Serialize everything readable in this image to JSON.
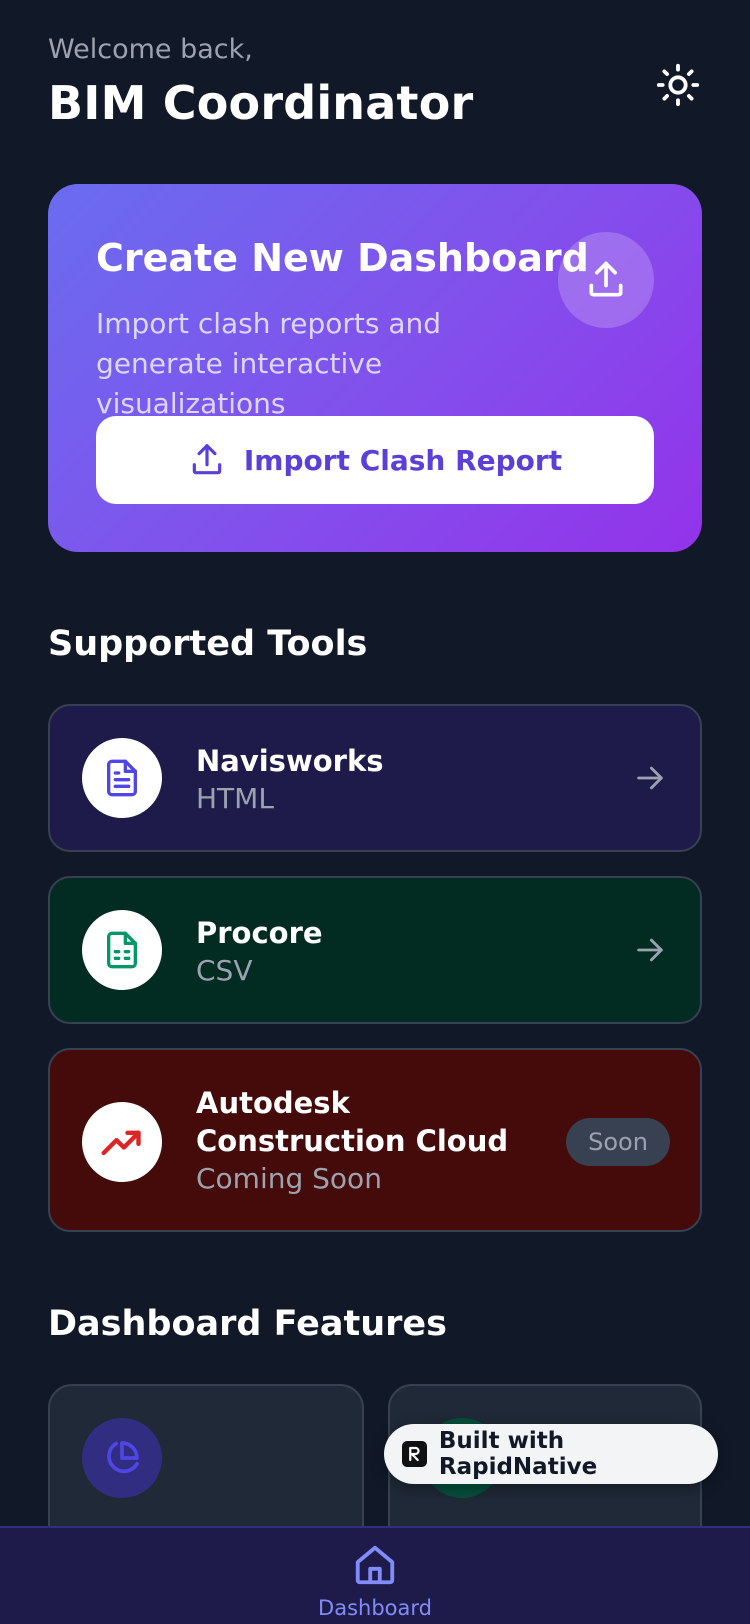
{
  "header": {
    "welcome": "Welcome back,",
    "user_role": "BIM Coordinator",
    "theme_toggle_icon": "sun-icon"
  },
  "hero": {
    "title": "Create New Dashboard",
    "subtitle": "Import clash reports and generate interactive visualizations",
    "badge_icon": "upload-icon",
    "button_label": "Import Clash Report",
    "button_icon": "upload-icon",
    "gradient": [
      "#6a6cf0",
      "#9333ea"
    ]
  },
  "tools_section": {
    "title": "Supported Tools",
    "items": [
      {
        "name": "Navisworks",
        "format": "HTML",
        "icon": "document-icon",
        "icon_color": "#4f46e5",
        "bg": "#1e1b4b",
        "action_icon": "arrow-right-icon"
      },
      {
        "name": "Procore",
        "format": "CSV",
        "icon": "spreadsheet-icon",
        "icon_color": "#059669",
        "bg": "#022c22",
        "action_icon": "arrow-right-icon"
      },
      {
        "name": "Autodesk Construction Cloud",
        "format": "Coming Soon",
        "icon": "trending-up-icon",
        "icon_color": "#dc2626",
        "bg": "#450a0a",
        "badge": "Soon"
      }
    ]
  },
  "features_section": {
    "title": "Dashboard Features",
    "items": [
      {
        "icon": "pie-chart-icon",
        "icon_bg": "#312e81",
        "icon_color": "#4f46e5"
      },
      {
        "icon": "feature-icon",
        "icon_bg": "#064e3b",
        "icon_color": "#059669"
      }
    ]
  },
  "rapidnative": {
    "label": "Built with RapidNative"
  },
  "bottom_nav": {
    "items": [
      {
        "label": "Dashboard",
        "icon": "home-icon",
        "active": true
      }
    ]
  }
}
